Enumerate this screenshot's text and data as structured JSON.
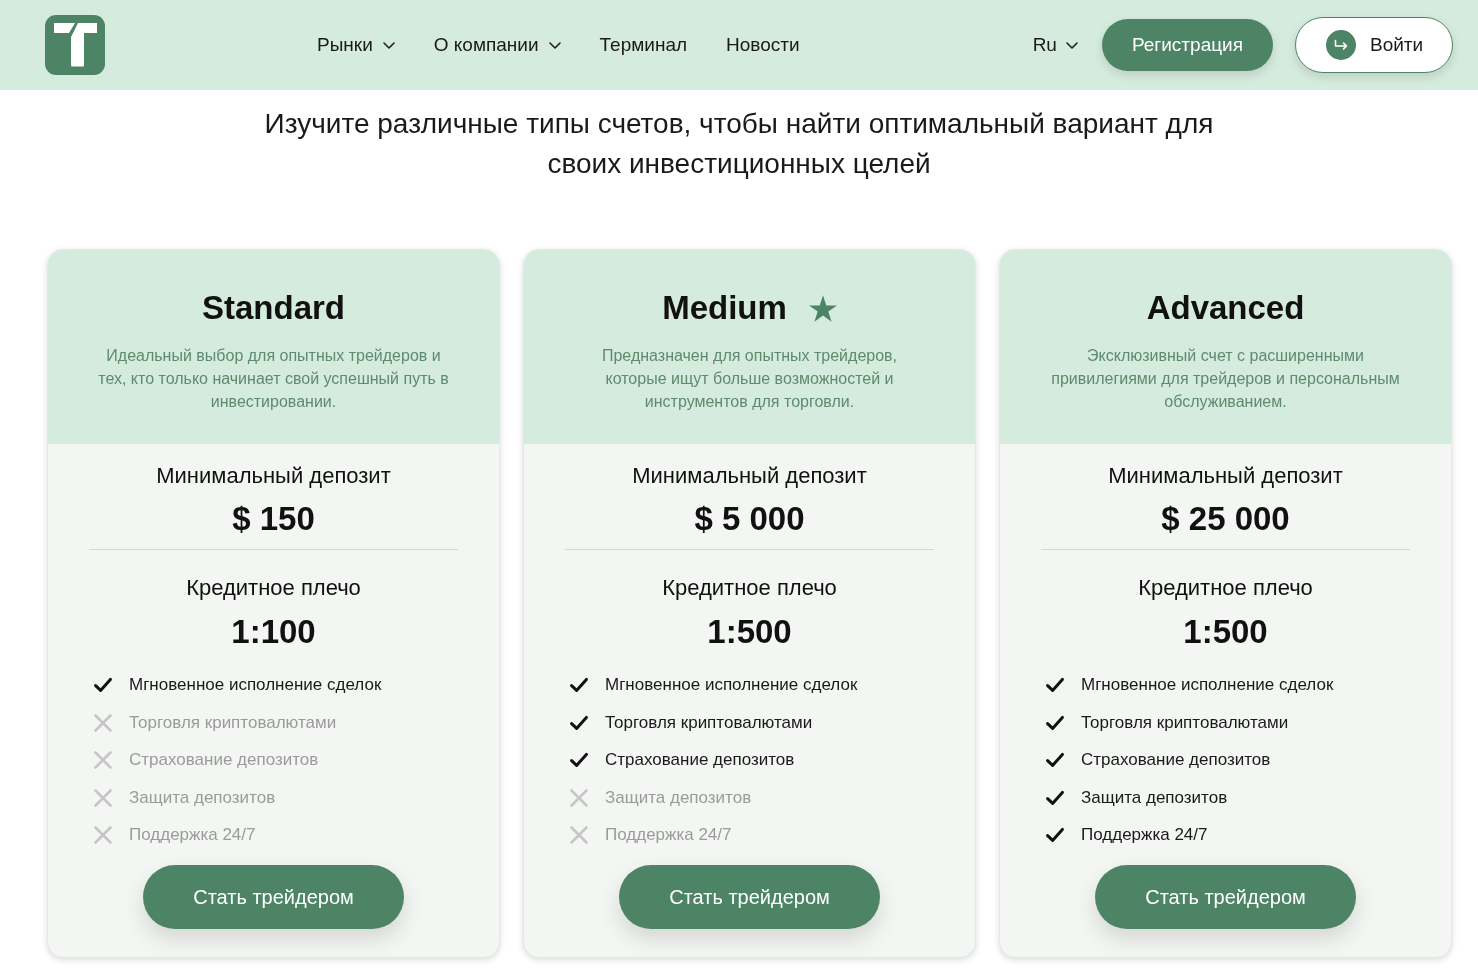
{
  "header": {
    "nav": [
      {
        "label": "Рынки",
        "dropdown": true
      },
      {
        "label": "О компании",
        "dropdown": true
      },
      {
        "label": "Терминал",
        "dropdown": false
      },
      {
        "label": "Новости",
        "dropdown": false
      }
    ],
    "language": {
      "label": "Ru",
      "dropdown": true
    },
    "register_button": "Регистрация",
    "login_button": "Войти"
  },
  "headline": "Изучите различные типы счетов, чтобы найти оптимальный вариант для своих инвестиционных целей",
  "plans": [
    {
      "name": "Standard",
      "featured": false,
      "description": "Идеальный выбор для опытных трейдеров и тех, кто только начинает свой успешный путь в инвестировании.",
      "deposit_label": "Минимальный депозит",
      "deposit": "$ 150",
      "leverage_label": "Кредитное плечо",
      "leverage": "1:100",
      "features": [
        {
          "label": "Мгновенное исполнение сделок",
          "included": true
        },
        {
          "label": "Торговля криптовалютами",
          "included": false
        },
        {
          "label": "Страхование депозитов",
          "included": false
        },
        {
          "label": "Защита депозитов",
          "included": false
        },
        {
          "label": "Поддержка 24/7",
          "included": false
        }
      ],
      "button": "Стать трейдером"
    },
    {
      "name": "Medium",
      "featured": true,
      "description": "Предназначен для опытных трейдеров, которые ищут больше возможностей и инструментов для торговли.",
      "deposit_label": "Минимальный депозит",
      "deposit": "$ 5 000",
      "leverage_label": "Кредитное плечо",
      "leverage": "1:500",
      "features": [
        {
          "label": "Мгновенное исполнение сделок",
          "included": true
        },
        {
          "label": "Торговля криптовалютами",
          "included": true
        },
        {
          "label": "Страхование депозитов",
          "included": true
        },
        {
          "label": "Защита депозитов",
          "included": false
        },
        {
          "label": "Поддержка 24/7",
          "included": false
        }
      ],
      "button": "Стать трейдером"
    },
    {
      "name": "Advanced",
      "featured": false,
      "description": "Эксклюзивный счет с расширенными привилегиями для трейдеров и персональным обслуживанием.",
      "deposit_label": "Минимальный депозит",
      "deposit": "$ 25 000",
      "leverage_label": "Кредитное плечо",
      "leverage": "1:500",
      "features": [
        {
          "label": "Мгновенное исполнение сделок",
          "included": true
        },
        {
          "label": "Торговля криптовалютами",
          "included": true
        },
        {
          "label": "Страхование депозитов",
          "included": true
        },
        {
          "label": "Защита депозитов",
          "included": true
        },
        {
          "label": "Поддержка 24/7",
          "included": true
        }
      ],
      "button": "Стать трейдером"
    }
  ]
}
